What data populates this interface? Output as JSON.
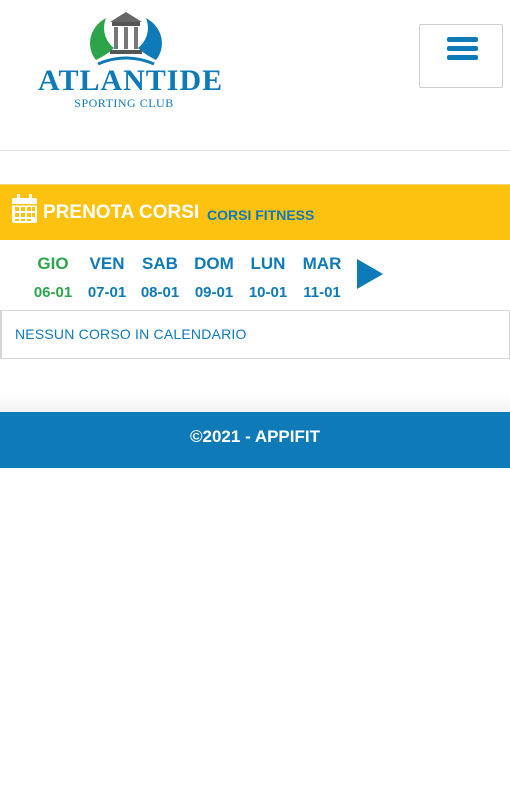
{
  "brand": {
    "title": "ATLANTIDE",
    "subtitle": "SPORTING CLUB",
    "colors": {
      "primary": "#0e7ab8",
      "accent": "#fdc20f",
      "active_day": "#2ca64a",
      "logo_green": "#2ea44a"
    }
  },
  "header": {
    "menu_icon": "hamburger-icon"
  },
  "booking": {
    "icon": "calendar-icon",
    "title": "PRENOTA CORSI",
    "category": "CORSI FITNESS"
  },
  "days": [
    {
      "name": "GIO",
      "date": "06-01",
      "active": true
    },
    {
      "name": "VEN",
      "date": "07-01",
      "active": false
    },
    {
      "name": "SAB",
      "date": "08-01",
      "active": false
    },
    {
      "name": "DOM",
      "date": "09-01",
      "active": false
    },
    {
      "name": "LUN",
      "date": "10-01",
      "active": false
    },
    {
      "name": "MAR",
      "date": "11-01",
      "active": false
    }
  ],
  "next_icon": "play-arrow-icon",
  "notice": "NESSUN CORSO IN CALENDARIO",
  "footer": {
    "text": "©2021 - APPIFIT"
  }
}
